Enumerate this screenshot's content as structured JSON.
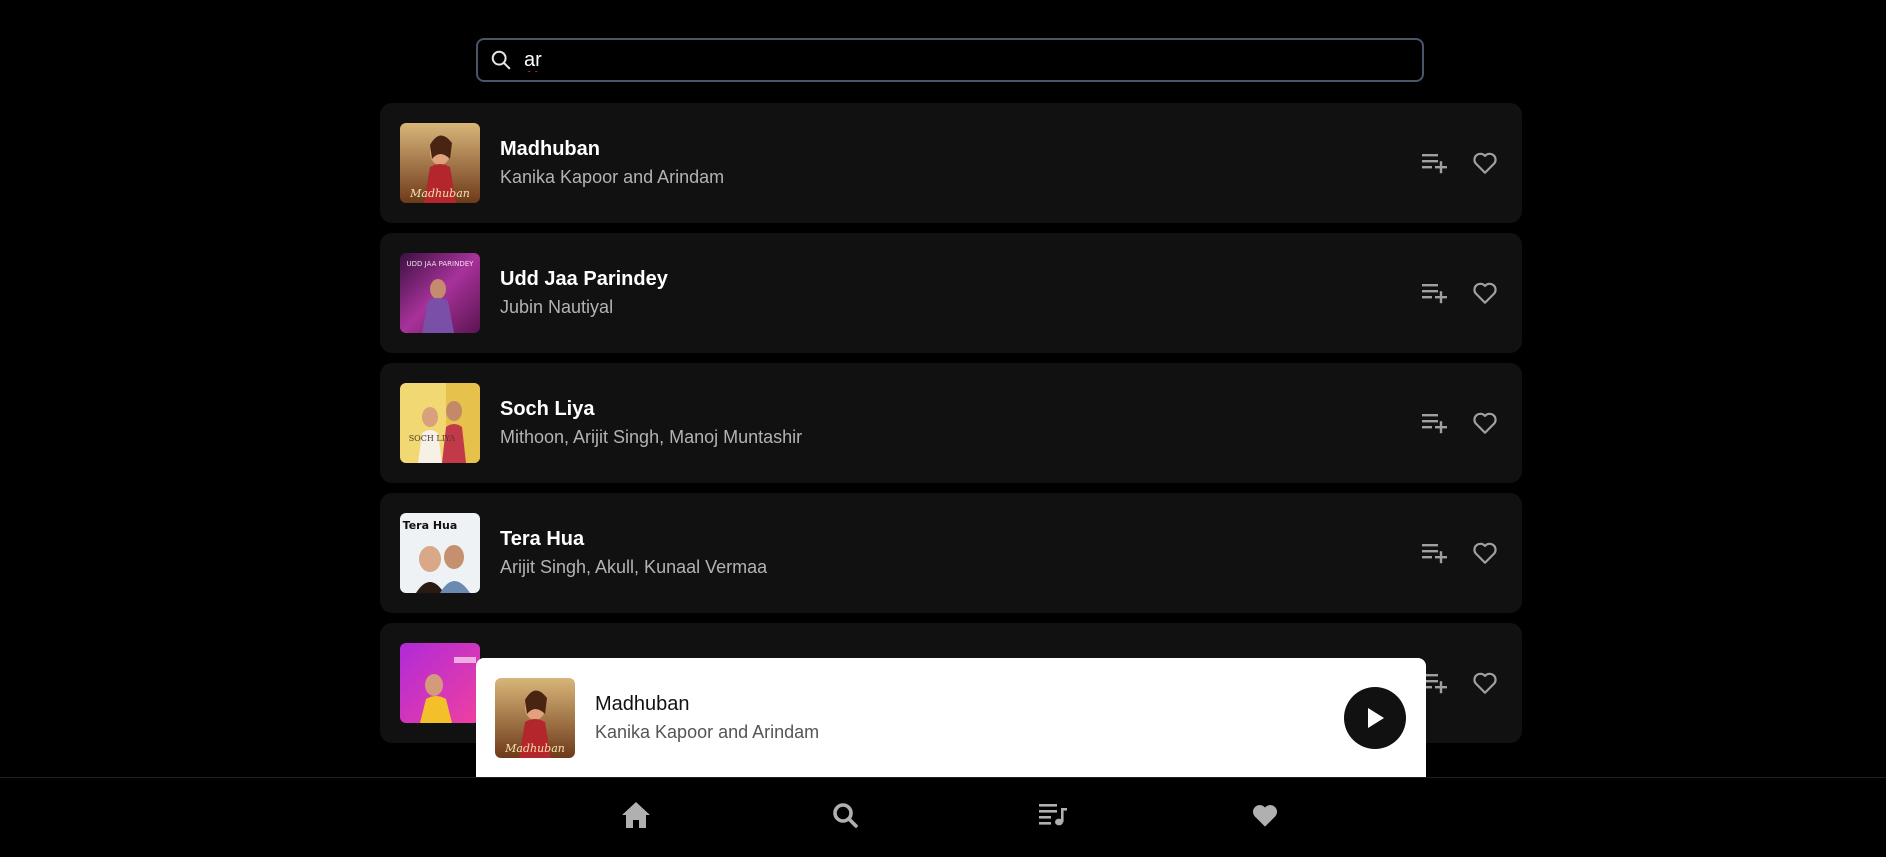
{
  "search": {
    "value": "ar",
    "icon": "search-icon"
  },
  "songs": [
    {
      "title": "Madhuban",
      "artist": "Kanika Kapoor and Arindam",
      "cover_text": "Madhuban",
      "colors": [
        "#c9a46a",
        "#8a3a1e",
        "#d6b37a"
      ]
    },
    {
      "title": "Udd Jaa Parindey",
      "artist": "Jubin Nautiyal",
      "cover_text": "UDD JAA PARINDEY",
      "colors": [
        "#7a1f6b",
        "#b13aa0",
        "#3b1040"
      ]
    },
    {
      "title": "Soch Liya",
      "artist": "Mithoon, Arijit Singh, Manoj Muntashir",
      "cover_text": "SOCH LIYA",
      "colors": [
        "#f4dd7a",
        "#e8c44a",
        "#b48a2a"
      ]
    },
    {
      "title": "Tera Hua",
      "artist": "Arijit Singh, Akull, Kunaal Vermaa",
      "cover_text": "Tera Hua",
      "colors": [
        "#e9eef2",
        "#b7c4d0",
        "#6b4a3a"
      ]
    },
    {
      "title": "",
      "artist": "",
      "cover_text": "",
      "colors": [
        "#c02bd8",
        "#ea3fa8",
        "#5a1a8a"
      ]
    }
  ],
  "now_playing": {
    "title": "Madhuban",
    "artist": "Kanika Kapoor and Arindam",
    "cover_text": "Madhuban"
  },
  "nav": [
    "home-icon",
    "search-icon",
    "playlist-icon",
    "heart-icon"
  ],
  "colors": {
    "background": "#000000",
    "card": "#111111",
    "muted_text": "#b3b3b3",
    "icon_gray": "#a0a0a0"
  }
}
